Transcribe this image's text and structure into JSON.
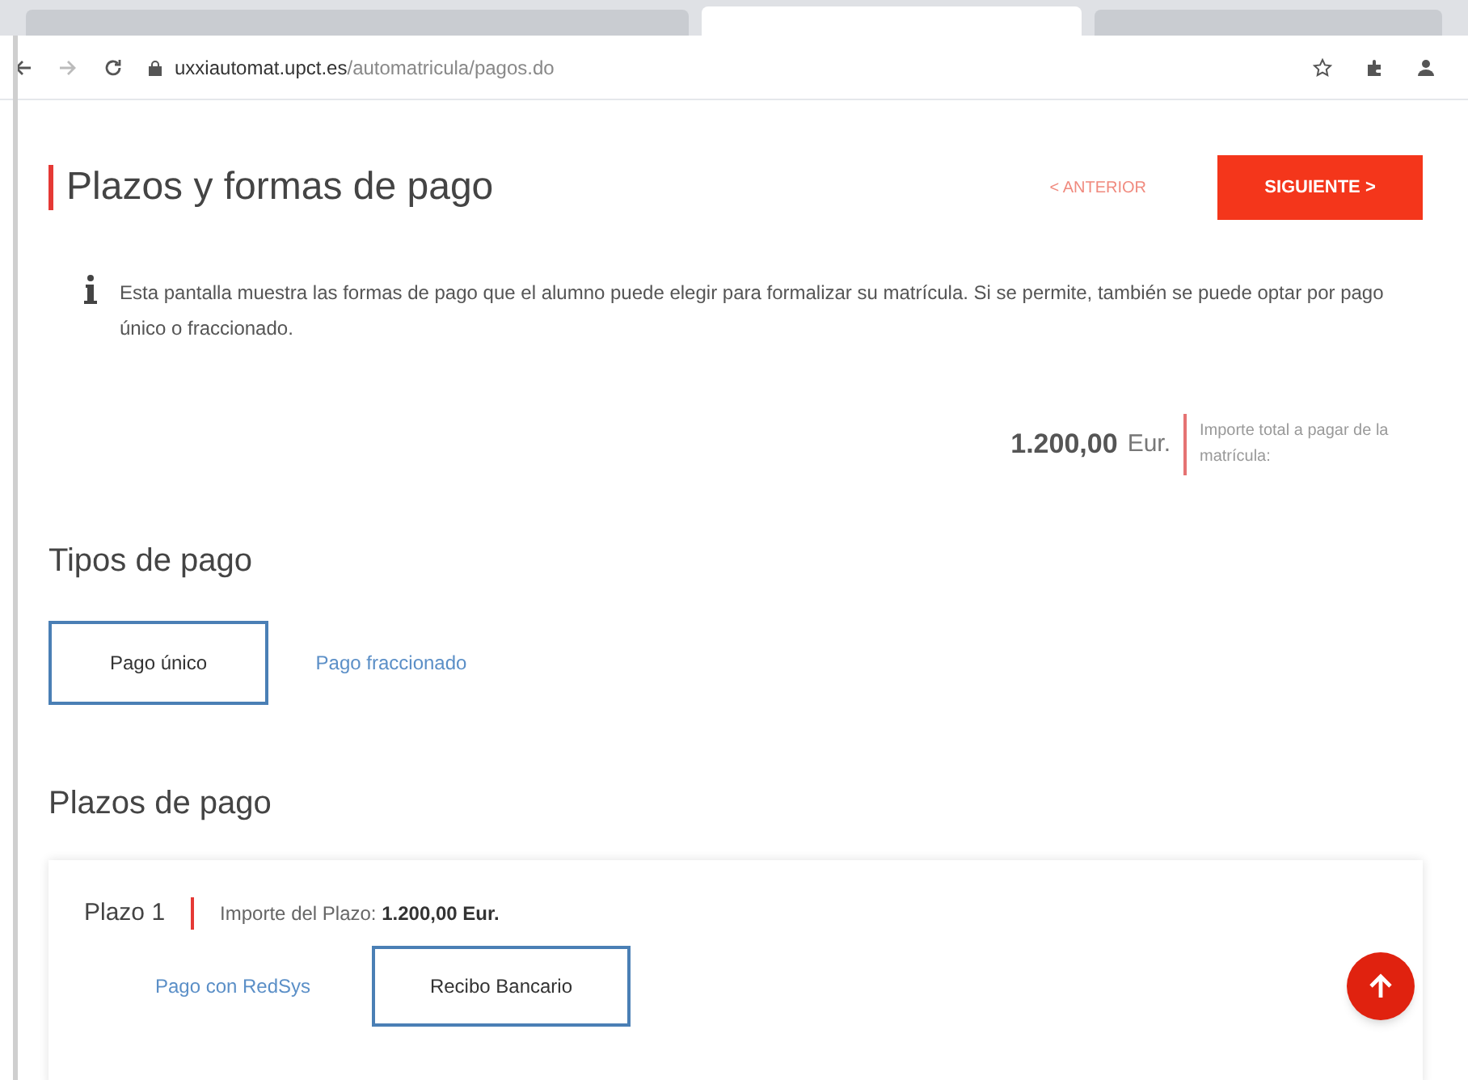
{
  "browser": {
    "tabs": [
      {
        "selected": false
      },
      {
        "selected": true
      },
      {
        "selected": false
      }
    ],
    "url_host": "uxxiautomat.upct.es",
    "url_path": "/automatricula/pagos.do"
  },
  "page": {
    "title": "Plazos y formas de pago",
    "prev_label": "< ANTERIOR",
    "next_label": "SIGUIENTE >",
    "info": "Esta pantalla muestra las formas de pago que el alumno puede elegir para formalizar su matrícula. Si se permite, también se puede optar por pago único o fraccionado.",
    "total_amount": "1.200,00",
    "total_currency": "Eur.",
    "total_label": "Importe total a pagar de la matrícula:"
  },
  "payment_types": {
    "heading": "Tipos de pago",
    "tabs": [
      {
        "label": "Pago único",
        "selected": true
      },
      {
        "label": "Pago fraccionado",
        "selected": false
      }
    ]
  },
  "installments": {
    "heading": "Plazos de pago",
    "items": [
      {
        "name": "Plazo 1",
        "amount_text": "Importe del Plazo: **1.200,00 Eur.**",
        "methods": [
          {
            "label": "Pago con RedSys",
            "selected": false
          },
          {
            "label": "Recibo Bancario",
            "selected": true
          }
        ]
      }
    ]
  }
}
